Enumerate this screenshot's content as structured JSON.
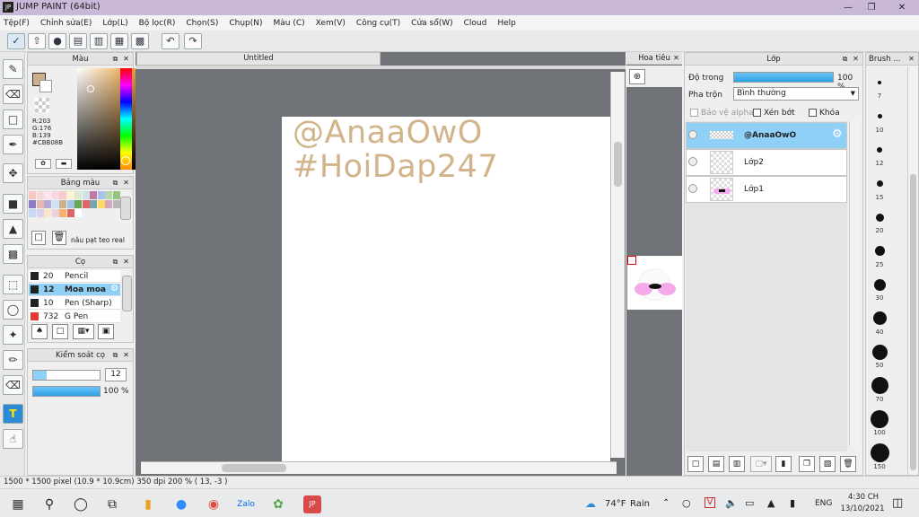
{
  "window": {
    "title": "JUMP PAINT (64bit)",
    "logo_text": "JP"
  },
  "menu": [
    "Tệp(F)",
    "Chỉnh sửa(E)",
    "Lớp(L)",
    "Bộ lọc(R)",
    "Chọn(S)",
    "Chụp(N)",
    "Màu (C)",
    "Xem(V)",
    "Công cụ(T)",
    "Cửa sổ(W)",
    "Cloud",
    "Help"
  ],
  "color_panel": {
    "title": "Màu",
    "r": "R:203",
    "g": "G:176",
    "b": "B:139",
    "hex": "#CBB08B",
    "current_color": "#CBB08B"
  },
  "palette_panel": {
    "title": "Bảng màu",
    "name": "nâu pạt teo real"
  },
  "brush_panel": {
    "title": "Cọ",
    "items": [
      {
        "size": "20",
        "name": "Pencil",
        "color": "#222222"
      },
      {
        "size": "12",
        "name": "Moa moa",
        "color": "#222222"
      },
      {
        "size": "10",
        "name": "Pen (Sharp)",
        "color": "#222222"
      },
      {
        "size": "732",
        "name": "G Pen",
        "color": "#e53935"
      }
    ],
    "selected_index": 1
  },
  "brush_control": {
    "title": "Kiểm soát cọ",
    "size_value": "12",
    "opacity_value": "100 %",
    "size_fraction": 0.2,
    "opacity_fraction": 1.0
  },
  "document": {
    "tab_title": "Untitled",
    "watermark_line1": "@AnaaOwO",
    "watermark_line2": "#HoiDap247"
  },
  "navigator": {
    "title": "Hoa tiêu"
  },
  "layer_panel": {
    "title": "Lớp",
    "opacity_label": "Độ trong",
    "opacity_value": "100 %",
    "blend_label": "Pha trộn",
    "blend_value": "Bình thường",
    "protect_alpha": "Bảo vệ alpha",
    "clip": "Xén bớt",
    "lock": "Khóa",
    "layers": [
      "@AnaaOwO",
      "Lớp2",
      "Lớp1"
    ]
  },
  "brush_sizes": {
    "title": "Brush ...",
    "items": [
      "7",
      "10",
      "12",
      "15",
      "20",
      "25",
      "30",
      "40",
      "50",
      "70",
      "100",
      "150"
    ]
  },
  "status": {
    "text": "1500 * 1500 pixel   (10.9 * 10.9cm)   350 dpi   200 %   ( 13, -3 )"
  },
  "taskbar": {
    "weather_temp": "74°F",
    "weather_text": "Rain",
    "lang": "ENG",
    "time": "4:30 CH",
    "date": "13/10/2021"
  }
}
